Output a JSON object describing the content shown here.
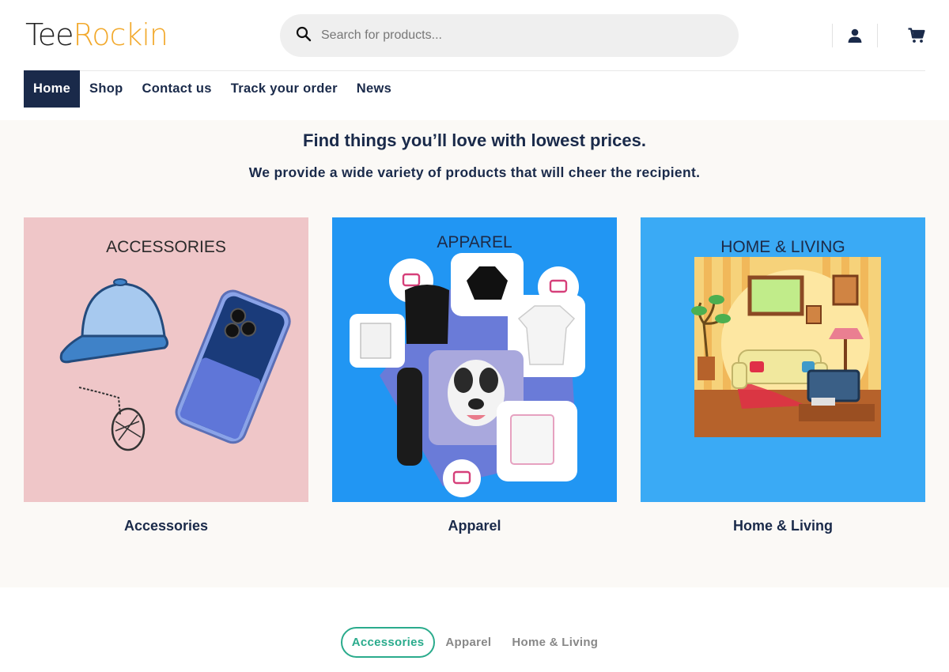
{
  "brand": {
    "logo_part1": "Tee",
    "logo_part2": "Rockin",
    "accent_color": "#f2a92c"
  },
  "search": {
    "placeholder": "Search for products...",
    "icon": "search-icon"
  },
  "header_icons": [
    "user-icon",
    "cart-icon"
  ],
  "nav": [
    {
      "label": "Home",
      "active": true
    },
    {
      "label": "Shop",
      "active": false
    },
    {
      "label": "Contact us",
      "active": false
    },
    {
      "label": "Track your order",
      "active": false
    },
    {
      "label": "News",
      "active": false
    }
  ],
  "hero": {
    "title": "Find things you’ll love with lowest prices.",
    "subtitle": "We provide a wide variety of products that will cheer the recipient."
  },
  "categories": [
    {
      "image_text": "ACCESSORIES",
      "caption": "Accessories",
      "bg": "#efc6c8"
    },
    {
      "image_text": "APPAREL",
      "caption": "Apparel",
      "bg": "#2196f3"
    },
    {
      "image_text": "HOME & LIVING",
      "caption": "Home & Living",
      "bg": "#3aaaf5"
    }
  ],
  "tabs": [
    {
      "label": "Accessories",
      "active": true
    },
    {
      "label": "Apparel",
      "active": false
    },
    {
      "label": "Home & Living",
      "active": false
    }
  ],
  "colors": {
    "navy": "#1a2a4a",
    "teal": "#2aab8c"
  }
}
